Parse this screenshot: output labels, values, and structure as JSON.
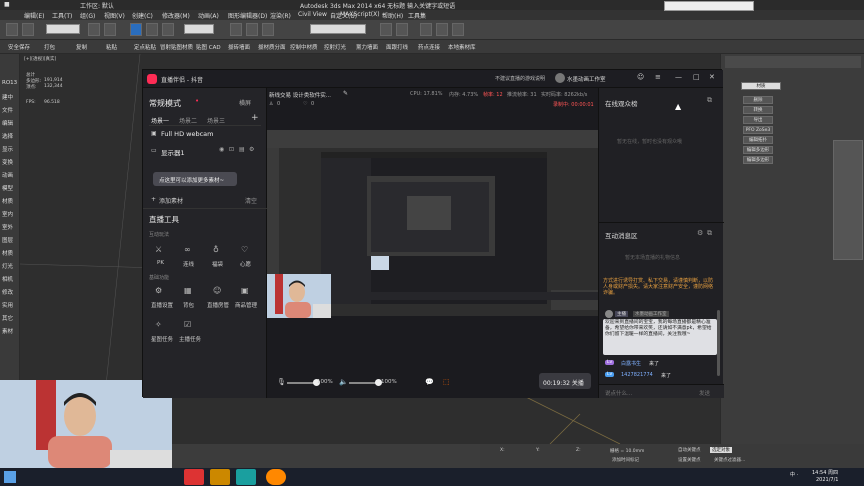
{
  "window_title": "Autodesk 3ds Max 2014 x64   无标题   输入关键字或短语",
  "workspace": "工作区: 默认",
  "max_menu": [
    "编辑(E)",
    "工具(T)",
    "组(G)",
    "视图(V)",
    "创建(C)",
    "修改器(M)",
    "动画(A)",
    "图形编辑器(D)",
    "渲染(R)",
    "Civil View",
    "自定义(U)",
    "MAXScript(X)",
    "帮助(H)",
    "工具集"
  ],
  "ribbon_items": [
    "安全保存",
    "打包",
    "复制",
    "粘贴",
    "定点粘贴",
    "冒射贴图材质",
    "贴图 CAD",
    "拔砖墙面",
    "拔材质分面",
    "控制中材质",
    "控射灯光",
    "黨力墙面",
    "面跟打线",
    "药点连接",
    "本地素材库"
  ],
  "left_panel": [
    "RO13",
    "建中",
    "文件",
    "编辑",
    "选择",
    "显示",
    "变换",
    "动画",
    "模型",
    "材质",
    "室内",
    "室外",
    "图层",
    "材质",
    "灯光",
    "相机",
    "修改",
    "实用",
    "其它",
    "素材"
  ],
  "viewport": {
    "label": "[+][透视][真实]",
    "stats": [
      {
        "label": "总计",
        "value": ""
      },
      {
        "label": "多边形:",
        "value": "191,914"
      },
      {
        "label": "顶点:",
        "value": "132,344"
      },
      {
        "label": "FPS:",
        "value": "96.518"
      }
    ]
  },
  "right_panel": {
    "buttons": [
      "删除",
      "转换",
      "导出",
      "PFO ZoSe3",
      "编辑拓扑",
      "编辑多边形",
      "编辑多边形"
    ],
    "dropdown": "材质"
  },
  "app": {
    "title": "直播伴侣 - 抖音",
    "notice": "不建议直播的游戏说明",
    "account": "水墨动画工作室",
    "mode": "常规模式",
    "scene_btn": "横屏",
    "scenes": [
      "场景一",
      "场景二",
      "场景三"
    ],
    "sources": [
      "Full HD webcam",
      "显示器1"
    ],
    "tip": "点这里可以添加更多素材~",
    "add_source": "添加素材",
    "clear": "清空",
    "tools_title": "直播工具",
    "interact_label": "互动玩法",
    "interact_tools": [
      "PK",
      "连线",
      "福袋",
      "心愿"
    ],
    "basic_label": "基础功能",
    "basic_tools": [
      "直播设置",
      "背包",
      "直播房管",
      "商品管理",
      "星图任务",
      "主播任务"
    ],
    "stream_title": "新线交易  设计类软件实...",
    "stream_stats": {
      "cpu": "CPU: 17.81%",
      "mem": "内存: 4.73%",
      "fps": "帧率: 12",
      "dropped": "推流帧率: 31",
      "bitrate": "实时码率: 8262kb/s",
      "rec": "录制中: 00:00:01"
    },
    "counts": [
      "0",
      "0"
    ],
    "volume_mic": "100%",
    "volume_speaker": "100%",
    "duration": "00:19:32 关播",
    "online_title": "在线观众榜",
    "online_empty": "暂无在线，暂时也没有观众哦",
    "chat_title": "互动消息区",
    "chat_empty": "暂无本场直播的礼物信息",
    "chat_notice": "方式进行诱导打赏、私下交易，请谨慎判断，以防人身或财产损失。请大家注意财产安全，谨防网络诈骗。",
    "messages": [
      {
        "user": "水墨动画工作室",
        "badge": "主播",
        "text": "欢迎来到直播间的宝宝，我的每场直播都是精心准备，希望给你带来欢笑，还请如不满意pk，希望给你们留下温暖一样的直播间，关注我哦~"
      },
      {
        "user": "白露书生",
        "badge": "Lv",
        "text": "来了"
      },
      {
        "user": "1427821774",
        "badge": "Lv",
        "text": "来了"
      }
    ],
    "chat_placeholder": "说点什么...",
    "chat_send": "发送"
  },
  "status": {
    "x_label": "X:",
    "y_label": "Y:",
    "z_label": "Z:",
    "grid": "栅格 = 10.0mm",
    "autokey": "自动关键点",
    "selected": "选定对象",
    "setkey": "设置关键点",
    "keyfilter": "关键点过滤器...",
    "addtime": "添加时间标记"
  },
  "taskbar": {
    "time": "14:54  周四",
    "date": "2021/7/1",
    "ime": "中 ·"
  }
}
